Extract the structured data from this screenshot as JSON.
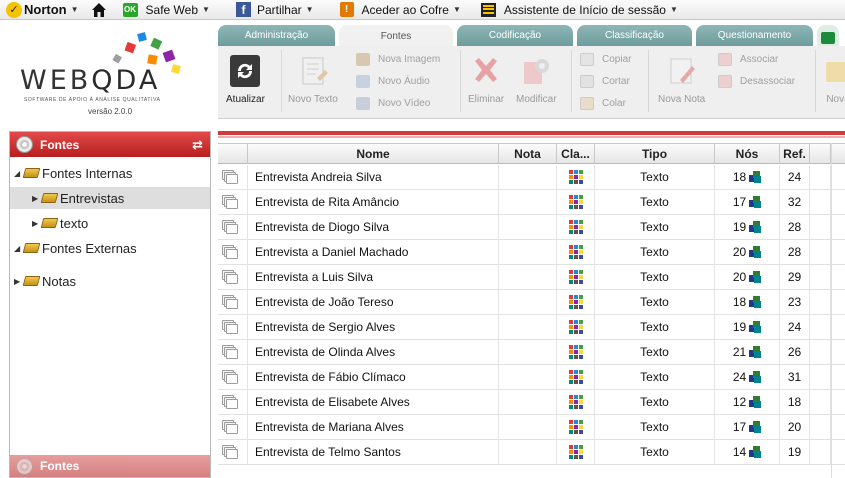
{
  "norton_bar": {
    "brand": "Norton",
    "check": "✓",
    "safe_web_badge": "OK",
    "safe_web": "Safe Web",
    "facebook_glyph": "f",
    "share": "Partilhar",
    "vault_glyph": "!",
    "vault": "Aceder ao Cofre",
    "assistant": "Assistente de Início de sessão"
  },
  "logo": {
    "name_a": "WEB",
    "name_b": "QDA",
    "subtitle": "SOFTWARE DE APOIO À ANÁLISE QUALITATIVA",
    "version": "versão 2.0.0"
  },
  "tabs": [
    "Administração",
    "Fontes",
    "Codificação",
    "Classificação",
    "Questionamento"
  ],
  "active_tab": "Fontes",
  "ribbon": {
    "refresh": "Atualizar",
    "new_text": "Novo Texto",
    "new_image": "Nova Imagem",
    "new_audio": "Novo Áudio",
    "new_video": "Novo Vídeo",
    "delete": "Eliminar",
    "modify": "Modificar",
    "copy": "Copiar",
    "cut": "Cortar",
    "paste": "Colar",
    "new_note": "Nova Nota",
    "associate": "Associar",
    "dissociate": "Desassociar",
    "more": "Nova"
  },
  "left_panel": {
    "title": "Fontes",
    "footer": "Fontes",
    "tree": {
      "internal": "Fontes Internas",
      "interviews": "Entrevistas",
      "text": "texto",
      "external": "Fontes Externas",
      "notes": "Notas"
    }
  },
  "table": {
    "headers": {
      "name": "Nome",
      "note": "Nota",
      "classification": "Cla...",
      "type": "Tipo",
      "nodes": "Nós",
      "refs": "Ref."
    },
    "rows": [
      {
        "name": "Entrevista Andreia Silva",
        "note": "",
        "type": "Texto",
        "nodes": "18",
        "refs": "24"
      },
      {
        "name": "Entrevista de Rita Amâncio",
        "note": "",
        "type": "Texto",
        "nodes": "17",
        "refs": "32"
      },
      {
        "name": "Entrevista de Diogo Silva",
        "note": "",
        "type": "Texto",
        "nodes": "19",
        "refs": "28"
      },
      {
        "name": "Entrevista a Daniel Machado",
        "note": "",
        "type": "Texto",
        "nodes": "20",
        "refs": "28"
      },
      {
        "name": "Entrevista a Luis Silva",
        "note": "",
        "type": "Texto",
        "nodes": "20",
        "refs": "29"
      },
      {
        "name": "Entrevista de João Tereso",
        "note": "",
        "type": "Texto",
        "nodes": "18",
        "refs": "23"
      },
      {
        "name": "Entrevista de Sergio Alves",
        "note": "",
        "type": "Texto",
        "nodes": "19",
        "refs": "24"
      },
      {
        "name": "Entrevista de Olinda Alves",
        "note": "",
        "type": "Texto",
        "nodes": "21",
        "refs": "26"
      },
      {
        "name": "Entrevista de Fábio Clímaco",
        "note": "",
        "type": "Texto",
        "nodes": "24",
        "refs": "31"
      },
      {
        "name": "Entrevista de Elisabete Alves",
        "note": "",
        "type": "Texto",
        "nodes": "12",
        "refs": "18"
      },
      {
        "name": "Entrevista de Mariana Alves",
        "note": "",
        "type": "Texto",
        "nodes": "17",
        "refs": "20"
      },
      {
        "name": "Entrevista de Telmo Santos",
        "note": "",
        "type": "Texto",
        "nodes": "14",
        "refs": "19"
      }
    ]
  },
  "colors": {
    "accent_red": "#c62828",
    "tab_teal": "#7ea9a9",
    "ribbon_bg": "#efefef"
  }
}
